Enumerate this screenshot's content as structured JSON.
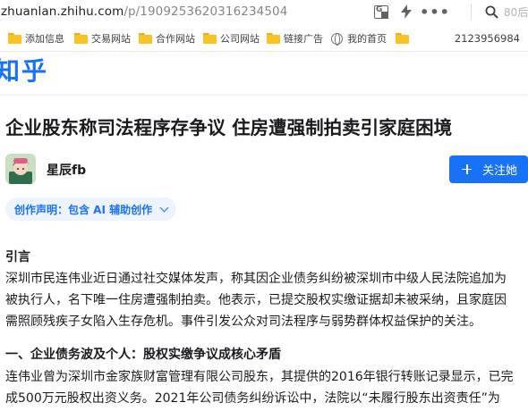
{
  "browser": {
    "url_host": "zhuanlan.zhihu.com",
    "url_path": "/p/1909253620316234504",
    "more_glyph": "•••",
    "search_hint": "80后"
  },
  "bookmarks": {
    "items": [
      {
        "label": "添加信息"
      },
      {
        "label": "交易网站"
      },
      {
        "label": "合作网站"
      },
      {
        "label": "公司网站"
      },
      {
        "label": "链接广告"
      },
      {
        "label": "我的首页"
      },
      {
        "label": ""
      }
    ],
    "number": "2123956984"
  },
  "header": {
    "logo": "知乎"
  },
  "article": {
    "title": "企业股东称司法程序存争议 住房遭强制拍卖引家庭困境",
    "author": "星辰fb",
    "follow_label": "关注她",
    "creation_tag": "创作声明：包含 AI 辅助创作",
    "intro_heading": "引言",
    "intro_lines": [
      "深圳市民连伟业近日通过社交媒体发声，称其因企业债务纠纷被深圳市中级人民法院追加为",
      "被执行人，名下唯一住房遭强制拍卖。他表示，已提交股权实缴证据却未被采纳，且家庭因",
      "需照顾残疾子女陷入生存危机。事件引发公众对司法程序与弱势群体权益保护的关注。"
    ],
    "section1_heading": "一、企业债务波及个人：股权实缴争议成核心矛盾",
    "section1_lines": [
      "连伟业曾为深圳市金家族财富管理有限公司股东，其提供的2016年银行转账记录显示，已完",
      "成500万元股权出资义务。2021年公司债务纠纷诉讼中，法院以“未履行股东出资责任”为"
    ]
  },
  "colors": {
    "accent": "#1772f6",
    "tag_bg": "#eef4fe"
  }
}
